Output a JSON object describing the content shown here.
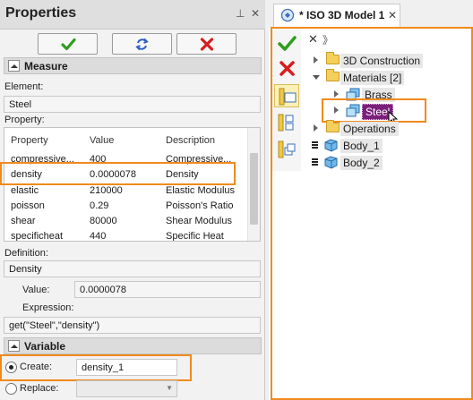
{
  "properties_panel": {
    "title": "Properties",
    "pin_glyph": "⊥",
    "close_glyph": "✕",
    "toolbar": {
      "ok_icon": "check-icon",
      "refresh_icon": "refresh-icon",
      "cancel_icon": "cancel-icon"
    },
    "measure": {
      "section_label": "Measure",
      "element_label": "Element:",
      "element_value": "Steel",
      "property_label": "Property:",
      "columns": [
        "Property",
        "Value",
        "Description"
      ],
      "rows": [
        {
          "property": "compressive...",
          "value": "400",
          "description": "Compressive..."
        },
        {
          "property": "density",
          "value": "0.0000078",
          "description": "Density"
        },
        {
          "property": "elastic",
          "value": "210000",
          "description": "Elastic Modulus"
        },
        {
          "property": "poisson",
          "value": "0.29",
          "description": "Poisson's Ratio"
        },
        {
          "property": "shear",
          "value": "80000",
          "description": "Shear Modulus"
        },
        {
          "property": "specificheat",
          "value": "440",
          "description": "Specific Heat"
        }
      ],
      "definition_label": "Definition:",
      "definition_value": "Density",
      "value_label": "Value:",
      "value_value": "0.0000078",
      "expression_label": "Expression:",
      "expression_value": "get(\"Steel\",\"density\")"
    },
    "variable": {
      "section_label": "Variable",
      "create_label": "Create:",
      "create_value": "density_1",
      "replace_label": "Replace:",
      "replace_value": ""
    }
  },
  "model_panel": {
    "tab_title": "* ISO 3D Model 1",
    "tab_close": "✕",
    "tree_close": "✕",
    "tree_expand": "》",
    "tree": [
      {
        "label": "3D Construction",
        "icon": "folder-icon",
        "expander": "collapsed"
      },
      {
        "label": "Materials [2]",
        "icon": "folder-icon",
        "expander": "expanded"
      },
      {
        "label": "Brass",
        "icon": "material-icon",
        "expander": "collapsed"
      },
      {
        "label": "Steel",
        "icon": "material-icon",
        "expander": "collapsed",
        "selected": true
      },
      {
        "label": "Operations",
        "icon": "folder-icon",
        "expander": "collapsed"
      },
      {
        "label": "Body_1",
        "icon": "body-icon",
        "expander": "none"
      },
      {
        "label": "Body_2",
        "icon": "body-icon",
        "expander": "none"
      }
    ]
  },
  "colors": {
    "highlight_orange": "#f08a1c",
    "ok_green": "#2e9d1c",
    "cancel_red": "#d71e1e",
    "refresh_blue": "#2d5fc6",
    "selected_purple": "#7a1f7a",
    "selected_tool_yellow": "#fbf0b6"
  }
}
